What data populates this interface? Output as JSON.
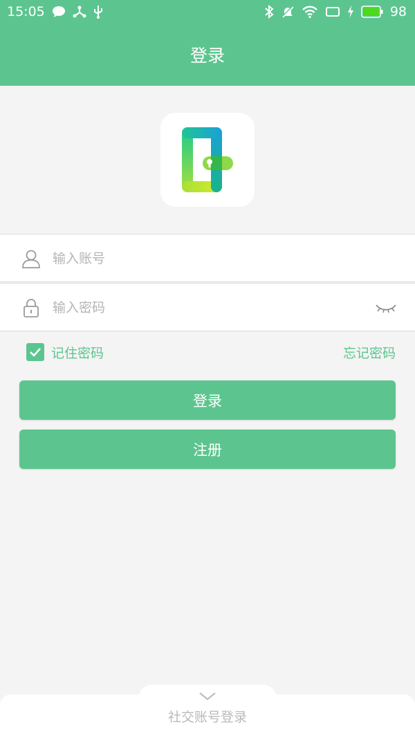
{
  "status_bar": {
    "time": "15:05",
    "battery": "98",
    "icons": [
      "chat-bubble-icon",
      "usb-debug-icon",
      "usb-icon",
      "bluetooth-icon",
      "bell-off-icon",
      "wifi-icon",
      "screen-rotate-icon",
      "charging-icon",
      "battery-icon"
    ]
  },
  "header": {
    "title": "登录"
  },
  "logo": {
    "icon": "phone-key-logo-icon"
  },
  "form": {
    "username_placeholder": "输入账号",
    "password_placeholder": "输入密码",
    "remember_label": "记住密码",
    "remember_checked": true,
    "forgot_label": "忘记密码"
  },
  "buttons": {
    "login": "登录",
    "register": "注册"
  },
  "bottom": {
    "social_login": "社交账号登录"
  },
  "colors": {
    "accent": "#5cc58f",
    "background": "#f4f4f4"
  }
}
